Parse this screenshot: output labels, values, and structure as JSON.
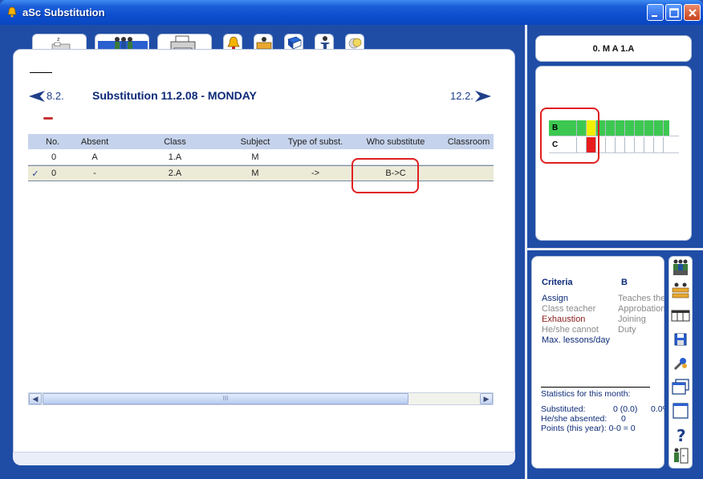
{
  "window": {
    "title": "aSc Substitution"
  },
  "header": {
    "prev_label": "8.2.",
    "title": "Substitution 11.2.08 - MONDAY",
    "next_label": "12.2."
  },
  "table": {
    "columns": [
      "No.",
      "Absent",
      "Class",
      "Subject",
      "Type of subst.",
      "Who substitute",
      "Classroom"
    ],
    "rows": [
      {
        "check": "",
        "no": "0",
        "absent": "A",
        "class": "1.A",
        "subject": "M",
        "type": "",
        "who": "",
        "classroom": ""
      },
      {
        "check": "✓",
        "no": "0",
        "absent": "-",
        "class": "2.A",
        "subject": "M",
        "type": "->",
        "who": "B->C",
        "classroom": ""
      }
    ]
  },
  "scrollbar": {
    "thumb_label": "III"
  },
  "right_top": {
    "header": "0. M A 1.A",
    "grid_rows": [
      {
        "label": "B",
        "cells": [
          "#3cc850",
          "#3cc850",
          "#f0f000",
          "#3cc850",
          "#3cc850",
          "#3cc850",
          "#3cc850",
          "#3cc850",
          "#3cc850",
          "#3cc850"
        ]
      },
      {
        "label": "C",
        "cells": [
          "#ffffff",
          "#ffffff",
          "#e81c1c",
          "#ffffff",
          "#ffffff",
          "#ffffff",
          "#ffffff",
          "#ffffff",
          "#ffffff",
          "#ffffff"
        ]
      }
    ]
  },
  "criteria": {
    "title": "Criteria",
    "teacher": "B",
    "left": [
      {
        "text": "Assign",
        "style": "link"
      },
      {
        "text": "Class teacher",
        "style": "gray"
      },
      {
        "text": "Exhaustion",
        "style": "red"
      },
      {
        "text": "He/she cannot",
        "style": "gray"
      },
      {
        "text": "Max. lessons/day",
        "style": "link"
      }
    ],
    "right": [
      {
        "text": "Teaches the",
        "style": "gray"
      },
      {
        "text": "Approbation",
        "style": "gray"
      },
      {
        "text": "Joining",
        "style": "gray"
      },
      {
        "text": "Duty",
        "style": "gray"
      }
    ]
  },
  "stats": {
    "heading": "Statistics for this month:",
    "substituted_label": "Substituted:",
    "substituted_value": "0 (0.0)",
    "substituted_extra": "0.0%",
    "absented_label": "He/she absented:",
    "absented_value": "0",
    "points": "Points (this year): 0-0 = 0"
  },
  "icons": {
    "tabs": [
      "sleep-icon",
      "teachers-icon",
      "printer-icon",
      "bell-icon",
      "classroom-icon",
      "book-icon",
      "person-icon",
      "coins-icon"
    ],
    "toolbar": [
      "teachers-icon",
      "classes-icon",
      "table-icon",
      "save-icon",
      "tools-icon",
      "windows-icon",
      "window-icon",
      "help-icon",
      "exit-icon"
    ]
  }
}
